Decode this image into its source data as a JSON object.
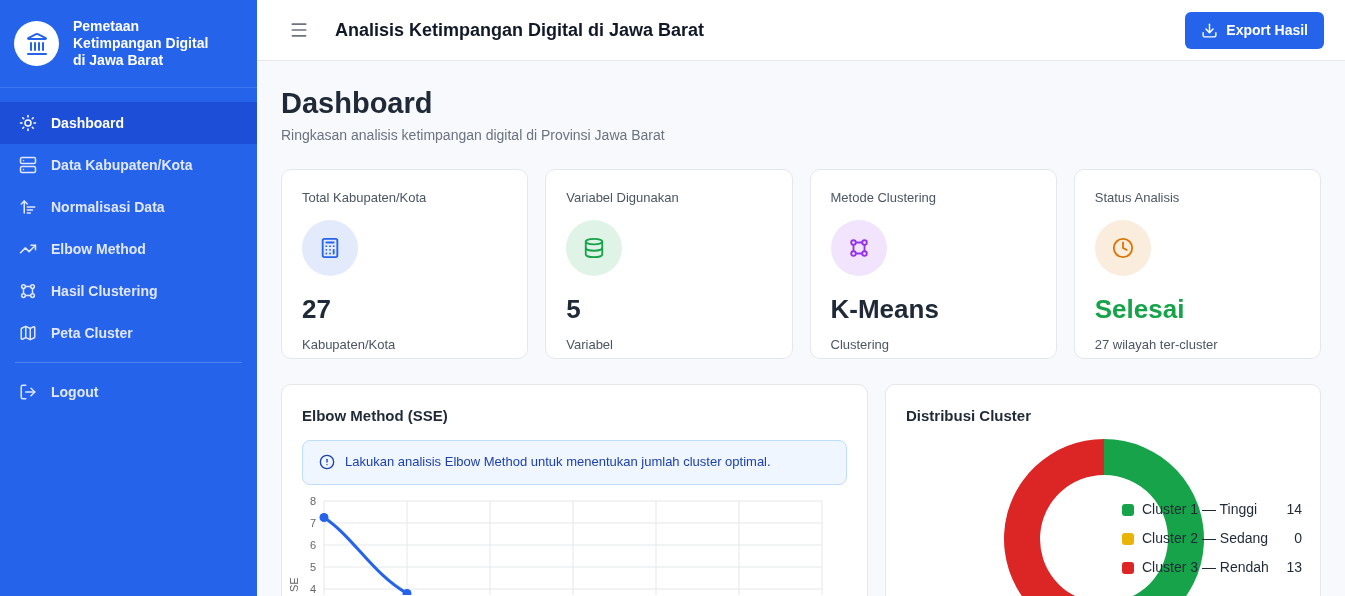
{
  "brand": {
    "title": "Pemetaan Ketimpangan Digital di Jawa Barat"
  },
  "sidebar": {
    "items": [
      {
        "label": "Dashboard",
        "selected": true
      },
      {
        "label": "Data Kabupaten/Kota",
        "selected": false
      },
      {
        "label": "Normalisasi Data",
        "selected": false
      },
      {
        "label": "Elbow Method",
        "selected": false
      },
      {
        "label": "Hasil Clustering",
        "selected": false
      },
      {
        "label": "Peta Cluster",
        "selected": false
      }
    ],
    "footer_items": [
      {
        "label": "Logout"
      }
    ]
  },
  "header": {
    "title": "Analisis Ketimpangan Digital di Jawa Barat",
    "button": "Export Hasil"
  },
  "page": {
    "title": "Dashboard",
    "subtitle": "Ringkasan analisis ketimpangan digital di Provinsi Jawa Barat"
  },
  "stats": [
    {
      "label": "Total Kabupaten/Kota",
      "value": "27",
      "caption": "Kabupaten/Kota",
      "color": "#2563eb",
      "kind": "number"
    },
    {
      "label": "Variabel Digunakan",
      "value": "5",
      "caption": "Variabel",
      "color": "#16a34a",
      "kind": "number"
    },
    {
      "label": "Metode Clustering",
      "value": "K-Means",
      "caption": "Clustering",
      "color": "#9333ea",
      "kind": "number"
    },
    {
      "label": "Status Analisis",
      "value": "Selesai",
      "caption": "27 wilayah ter-cluster",
      "color": "#d97706",
      "kind": "status"
    }
  ],
  "elbow": {
    "title": "Elbow Method (SSE)",
    "alert": "Lakukan analisis Elbow Method untuk menentukan jumlah cluster optimal.",
    "y_axis_labels": [
      "8",
      "7",
      "6",
      "5",
      "4"
    ],
    "axis_title": "SE"
  },
  "distribution": {
    "title": "Distribusi Cluster",
    "chart_data": {
      "type": "donut",
      "categories": [
        "Cluster 1 — Tinggi",
        "Cluster 2 — Sedang",
        "Cluster 3 — Rendah"
      ],
      "series": [
        {
          "values": [
            51.85,
            0,
            48.15
          ]
        }
      ],
      "colors": [
        "#16a34a",
        "#eab308",
        "#dc2626"
      ]
    },
    "legend_values": [
      "14",
      "0",
      "13"
    ]
  }
}
